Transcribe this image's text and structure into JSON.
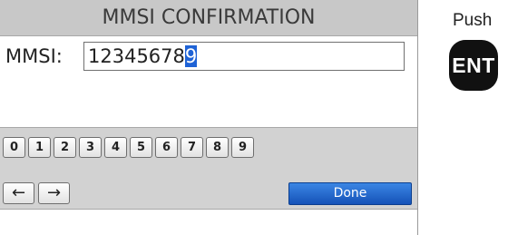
{
  "screen": {
    "title": "MMSI CONFIRMATION",
    "field_label": "MMSI:",
    "field_value_prefix": "12345678",
    "field_value_cursor": "9"
  },
  "keypad": {
    "digits": [
      "0",
      "1",
      "2",
      "3",
      "4",
      "5",
      "6",
      "7",
      "8",
      "9"
    ],
    "left_arrow": "←",
    "right_arrow": "→",
    "done_label": "Done"
  },
  "instruction": {
    "push_label": "Push",
    "key_label": "ENT"
  },
  "colors": {
    "title_bar": "#c8c8c8",
    "keypad_bg": "#d2d2d2",
    "cursor_highlight": "#1f63d6",
    "done_button": "#1f63d6",
    "ent_key": "#111111"
  }
}
